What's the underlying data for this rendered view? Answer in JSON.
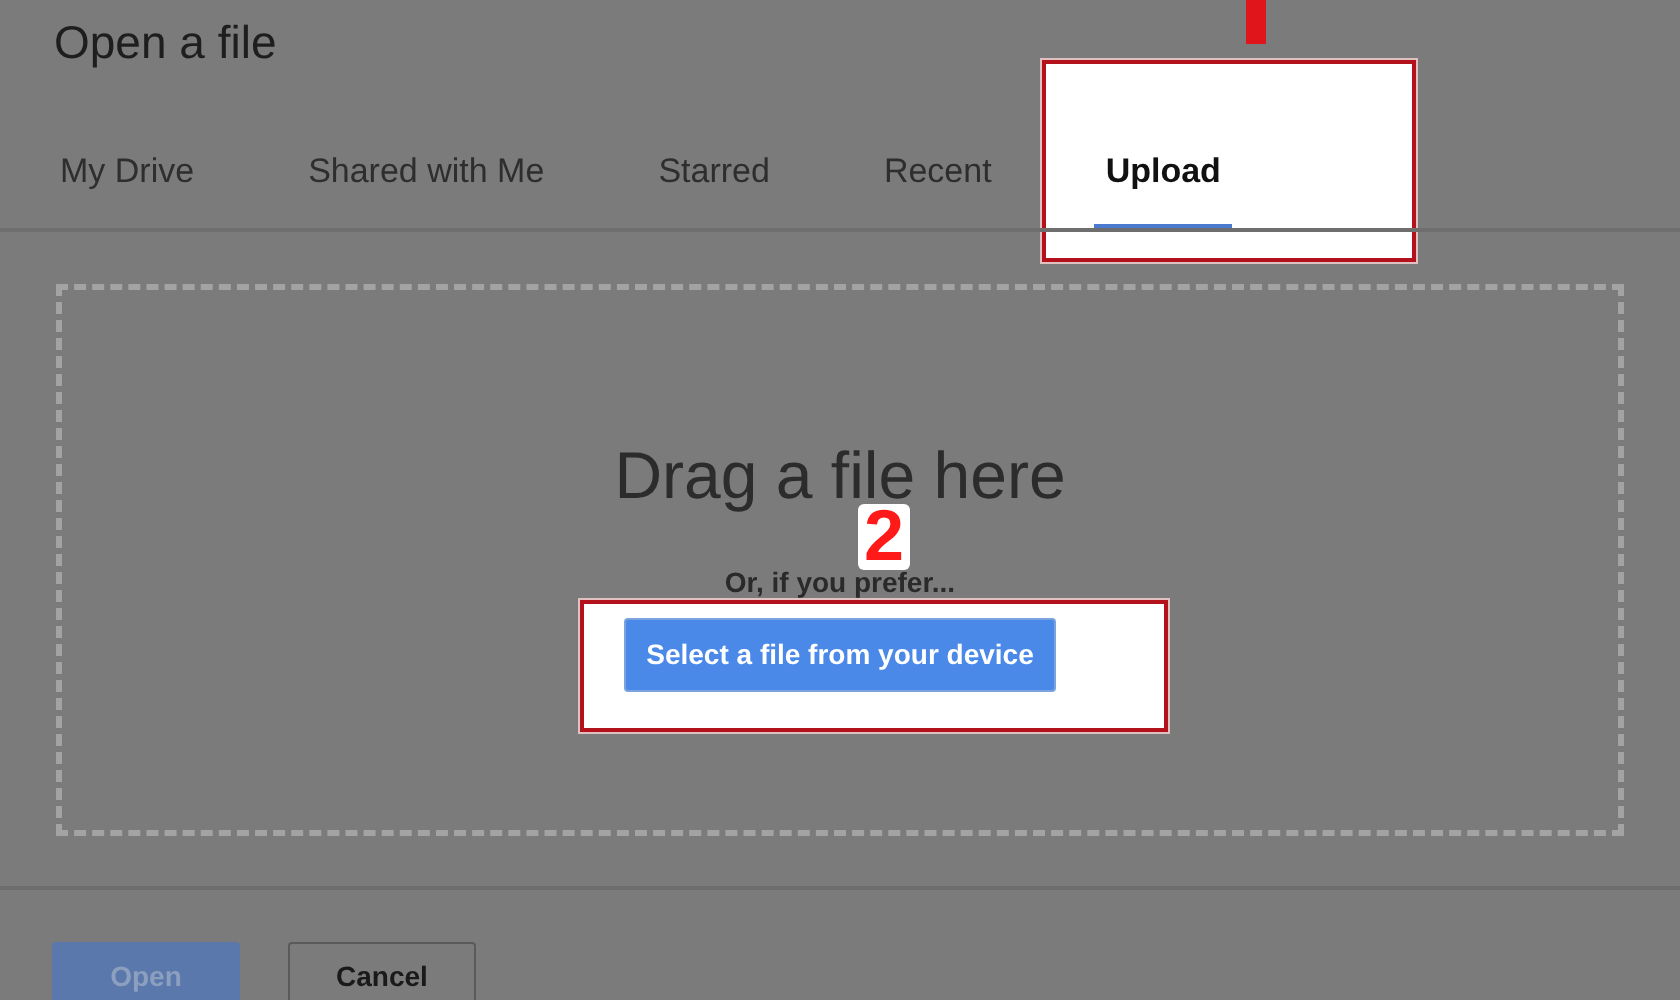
{
  "dialog": {
    "title": "Open a file"
  },
  "tabs": [
    {
      "label": "My Drive",
      "selected": false
    },
    {
      "label": "Shared with Me",
      "selected": false
    },
    {
      "label": "Starred",
      "selected": false
    },
    {
      "label": "Recent",
      "selected": false
    },
    {
      "label": "Upload",
      "selected": true
    }
  ],
  "drop_zone": {
    "heading": "Drag a file here",
    "hint": "Or, if you prefer...",
    "button": "Select a file from your device"
  },
  "footer_buttons": [
    {
      "label": "Open",
      "disabled": true
    },
    {
      "label": "Cancel",
      "disabled": false
    }
  ],
  "annotations": [
    {
      "kind": "cut-number"
    },
    {
      "kind": "highlight"
    },
    {
      "kind": "highlight"
    },
    {
      "kind": "number",
      "label": "2"
    }
  ]
}
